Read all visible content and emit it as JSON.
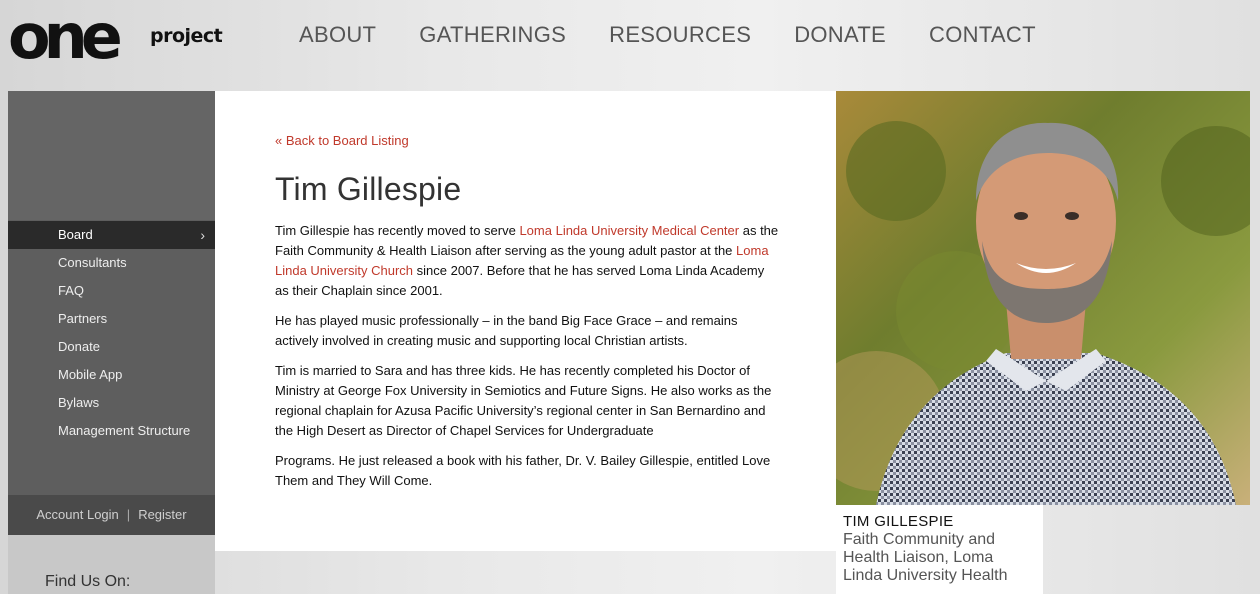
{
  "logo": {
    "main": "one",
    "sub": "project"
  },
  "nav": [
    "ABOUT",
    "GATHERINGS",
    "RESOURCES",
    "DONATE",
    "CONTACT"
  ],
  "sidebar": {
    "items": [
      {
        "label": "Board",
        "active": true
      },
      {
        "label": "Consultants"
      },
      {
        "label": "FAQ"
      },
      {
        "label": "Partners"
      },
      {
        "label": "Donate"
      },
      {
        "label": "Mobile App"
      },
      {
        "label": "Bylaws"
      },
      {
        "label": "Management Structure"
      }
    ],
    "account_login": "Account Login",
    "separator": "|",
    "register": "Register",
    "find_us": "Find Us On:"
  },
  "content": {
    "back_link": "« Back to Board Listing",
    "title": "Tim Gillespie",
    "p1_a": "Tim Gillespie has recently moved to serve ",
    "p1_link1": "Loma Linda University Medical Center",
    "p1_b": " as the Faith Community & Health Liaison after serving as the young adult pastor at the ",
    "p1_link2": "Loma Linda University Church",
    "p1_c": " since 2007. Before that he has served Loma Linda Academy as their Chaplain since 2001.",
    "p2": "He has played music professionally – in the band Big Face Grace – and remains actively involved in creating music and supporting local Christian artists.",
    "p3": "Tim is married to Sara and has three kids. He has recently completed his Doctor of Ministry at George Fox University in Semiotics and Future Signs. He also works as the regional chaplain for Azusa Pacific University’s regional center in San Bernardino and the High Desert as Director of Chapel Services for Undergraduate",
    "p4": "Programs. He just released a book with his father, Dr. V. Bailey Gillespie, entitled Love Them and They Will Come."
  },
  "caption": {
    "name": "TIM GILLESPIE",
    "role": "Faith Community and Health Liaison, Loma Linda University Health"
  },
  "colors": {
    "link": "#c0392b",
    "sidebar": "#5e5e5e",
    "active": "#2a2a2a"
  }
}
